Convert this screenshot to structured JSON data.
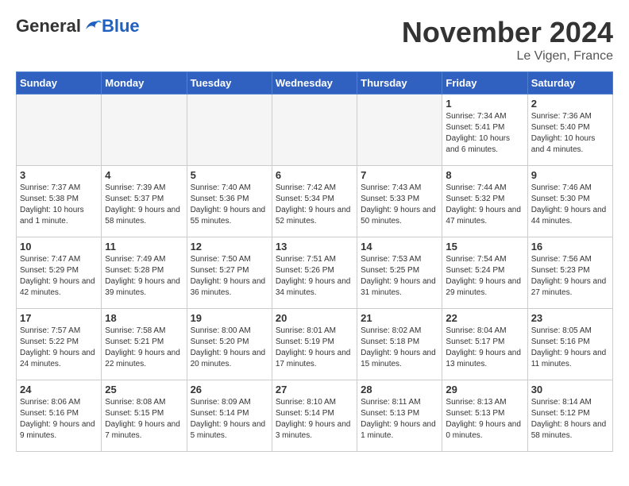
{
  "logo": {
    "general": "General",
    "blue": "Blue"
  },
  "title": "November 2024",
  "location": "Le Vigen, France",
  "days_of_week": [
    "Sunday",
    "Monday",
    "Tuesday",
    "Wednesday",
    "Thursday",
    "Friday",
    "Saturday"
  ],
  "weeks": [
    [
      {
        "day": "",
        "info": "",
        "empty": true
      },
      {
        "day": "",
        "info": "",
        "empty": true
      },
      {
        "day": "",
        "info": "",
        "empty": true
      },
      {
        "day": "",
        "info": "",
        "empty": true
      },
      {
        "day": "",
        "info": "",
        "empty": true
      },
      {
        "day": "1",
        "info": "Sunrise: 7:34 AM\nSunset: 5:41 PM\nDaylight: 10 hours\nand 6 minutes."
      },
      {
        "day": "2",
        "info": "Sunrise: 7:36 AM\nSunset: 5:40 PM\nDaylight: 10 hours\nand 4 minutes."
      }
    ],
    [
      {
        "day": "3",
        "info": "Sunrise: 7:37 AM\nSunset: 5:38 PM\nDaylight: 10 hours\nand 1 minute."
      },
      {
        "day": "4",
        "info": "Sunrise: 7:39 AM\nSunset: 5:37 PM\nDaylight: 9 hours\nand 58 minutes."
      },
      {
        "day": "5",
        "info": "Sunrise: 7:40 AM\nSunset: 5:36 PM\nDaylight: 9 hours\nand 55 minutes."
      },
      {
        "day": "6",
        "info": "Sunrise: 7:42 AM\nSunset: 5:34 PM\nDaylight: 9 hours\nand 52 minutes."
      },
      {
        "day": "7",
        "info": "Sunrise: 7:43 AM\nSunset: 5:33 PM\nDaylight: 9 hours\nand 50 minutes."
      },
      {
        "day": "8",
        "info": "Sunrise: 7:44 AM\nSunset: 5:32 PM\nDaylight: 9 hours\nand 47 minutes."
      },
      {
        "day": "9",
        "info": "Sunrise: 7:46 AM\nSunset: 5:30 PM\nDaylight: 9 hours\nand 44 minutes."
      }
    ],
    [
      {
        "day": "10",
        "info": "Sunrise: 7:47 AM\nSunset: 5:29 PM\nDaylight: 9 hours\nand 42 minutes."
      },
      {
        "day": "11",
        "info": "Sunrise: 7:49 AM\nSunset: 5:28 PM\nDaylight: 9 hours\nand 39 minutes."
      },
      {
        "day": "12",
        "info": "Sunrise: 7:50 AM\nSunset: 5:27 PM\nDaylight: 9 hours\nand 36 minutes."
      },
      {
        "day": "13",
        "info": "Sunrise: 7:51 AM\nSunset: 5:26 PM\nDaylight: 9 hours\nand 34 minutes."
      },
      {
        "day": "14",
        "info": "Sunrise: 7:53 AM\nSunset: 5:25 PM\nDaylight: 9 hours\nand 31 minutes."
      },
      {
        "day": "15",
        "info": "Sunrise: 7:54 AM\nSunset: 5:24 PM\nDaylight: 9 hours\nand 29 minutes."
      },
      {
        "day": "16",
        "info": "Sunrise: 7:56 AM\nSunset: 5:23 PM\nDaylight: 9 hours\nand 27 minutes."
      }
    ],
    [
      {
        "day": "17",
        "info": "Sunrise: 7:57 AM\nSunset: 5:22 PM\nDaylight: 9 hours\nand 24 minutes."
      },
      {
        "day": "18",
        "info": "Sunrise: 7:58 AM\nSunset: 5:21 PM\nDaylight: 9 hours\nand 22 minutes."
      },
      {
        "day": "19",
        "info": "Sunrise: 8:00 AM\nSunset: 5:20 PM\nDaylight: 9 hours\nand 20 minutes."
      },
      {
        "day": "20",
        "info": "Sunrise: 8:01 AM\nSunset: 5:19 PM\nDaylight: 9 hours\nand 17 minutes."
      },
      {
        "day": "21",
        "info": "Sunrise: 8:02 AM\nSunset: 5:18 PM\nDaylight: 9 hours\nand 15 minutes."
      },
      {
        "day": "22",
        "info": "Sunrise: 8:04 AM\nSunset: 5:17 PM\nDaylight: 9 hours\nand 13 minutes."
      },
      {
        "day": "23",
        "info": "Sunrise: 8:05 AM\nSunset: 5:16 PM\nDaylight: 9 hours\nand 11 minutes."
      }
    ],
    [
      {
        "day": "24",
        "info": "Sunrise: 8:06 AM\nSunset: 5:16 PM\nDaylight: 9 hours\nand 9 minutes."
      },
      {
        "day": "25",
        "info": "Sunrise: 8:08 AM\nSunset: 5:15 PM\nDaylight: 9 hours\nand 7 minutes."
      },
      {
        "day": "26",
        "info": "Sunrise: 8:09 AM\nSunset: 5:14 PM\nDaylight: 9 hours\nand 5 minutes."
      },
      {
        "day": "27",
        "info": "Sunrise: 8:10 AM\nSunset: 5:14 PM\nDaylight: 9 hours\nand 3 minutes."
      },
      {
        "day": "28",
        "info": "Sunrise: 8:11 AM\nSunset: 5:13 PM\nDaylight: 9 hours\nand 1 minute."
      },
      {
        "day": "29",
        "info": "Sunrise: 8:13 AM\nSunset: 5:13 PM\nDaylight: 9 hours\nand 0 minutes."
      },
      {
        "day": "30",
        "info": "Sunrise: 8:14 AM\nSunset: 5:12 PM\nDaylight: 8 hours\nand 58 minutes."
      }
    ]
  ]
}
